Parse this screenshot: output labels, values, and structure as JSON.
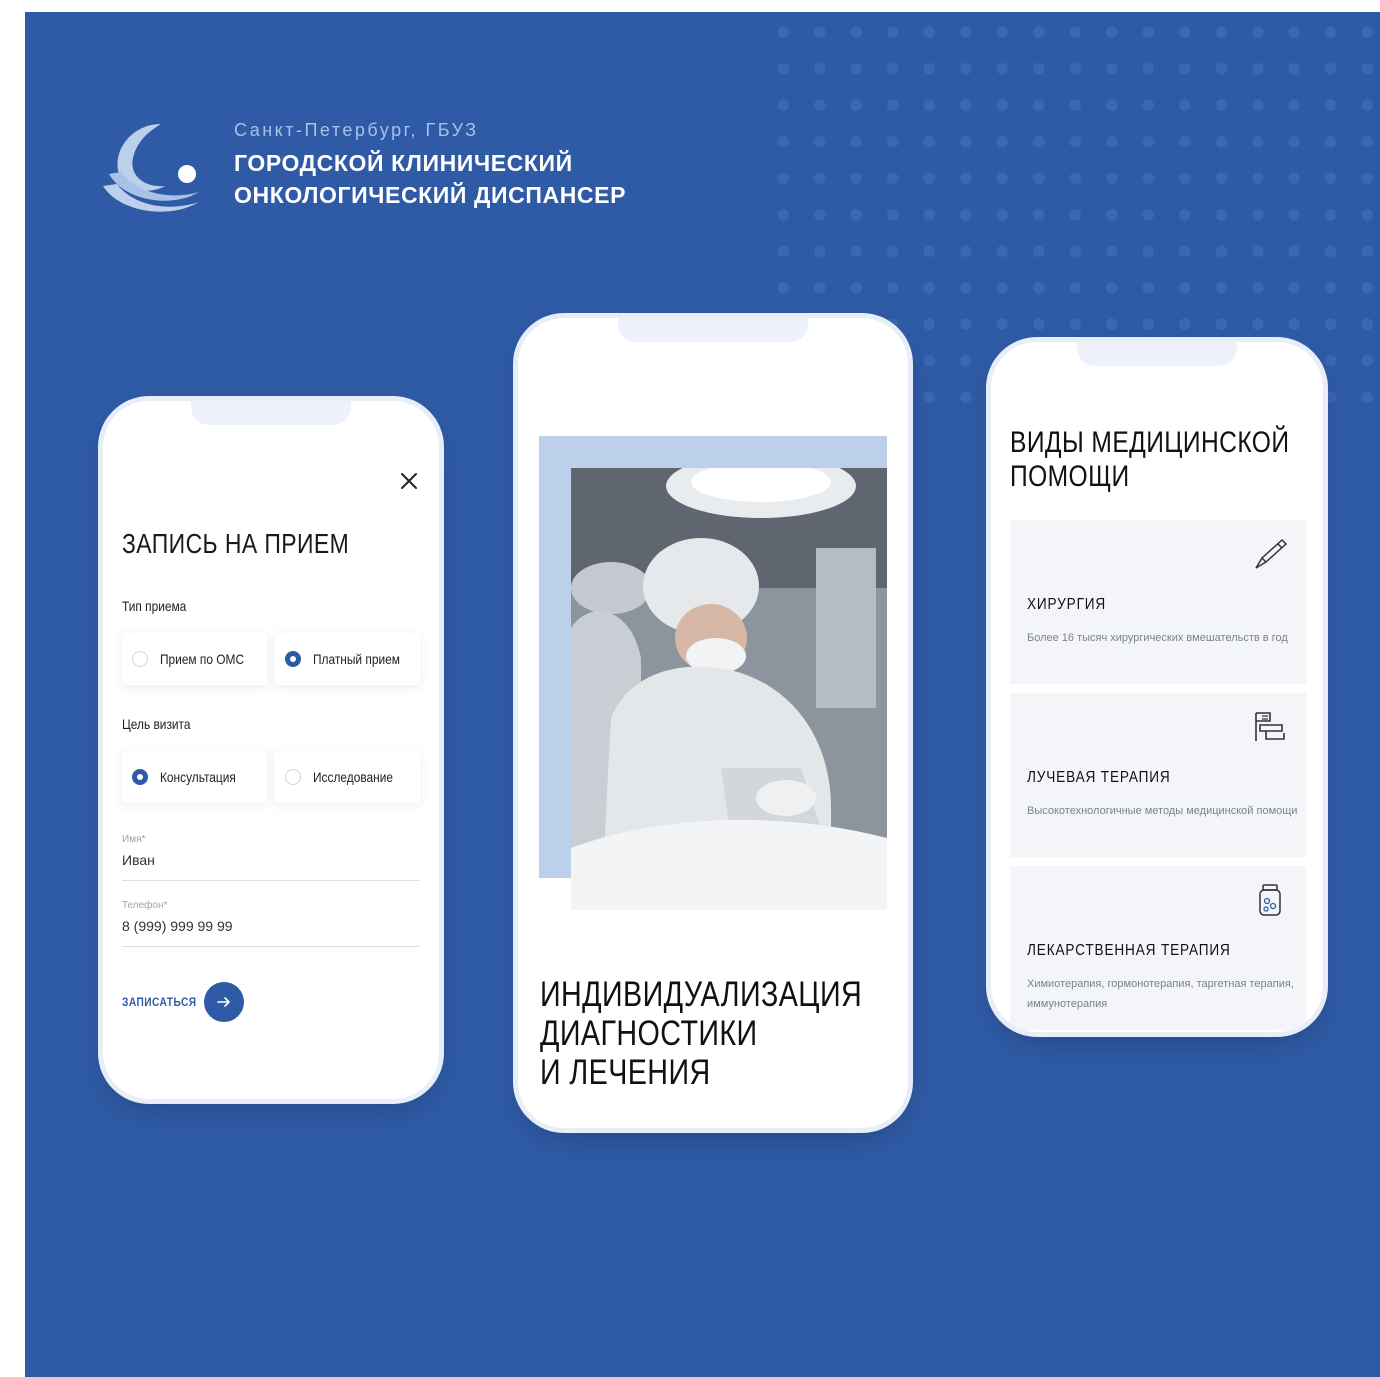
{
  "brand": {
    "subtitle": "Санкт-Петербург, ГБУЗ",
    "line1": "ГОРОДСКОЙ КЛИНИЧЕСКИЙ",
    "line2": "ОНКОЛОГИЧЕСКИЙ ДИСПАНСЕР"
  },
  "colors": {
    "background": "#2f5ba6",
    "accent": "#2f5ba6",
    "card": "#f3f5f9",
    "photo_accent": "#bcd0ec"
  },
  "appointment": {
    "title": "ЗАПИСЬ НА ПРИЕМ",
    "type_label": "Тип приема",
    "type_options": [
      {
        "label": "Прием по ОМС",
        "selected": false
      },
      {
        "label": "Платный прием",
        "selected": true
      }
    ],
    "goal_label": "Цель визита",
    "goal_options": [
      {
        "label": "Консультация",
        "selected": true
      },
      {
        "label": "Исследование",
        "selected": false
      }
    ],
    "name_field": {
      "label": "Имя*",
      "value": "Иван"
    },
    "phone_field": {
      "label": "Телефон*",
      "value": "8 (999) 999 99 99"
    },
    "submit_label": "ЗАПИСАТЬСЯ",
    "close_icon": "close-icon",
    "submit_icon": "arrow-right-icon"
  },
  "hero": {
    "title_lines": [
      "ИНДИВИДУАЛИЗАЦИЯ",
      "ДИАГНОСТИКИ",
      "И ЛЕЧЕНИЯ"
    ]
  },
  "services": {
    "title_lines": [
      "ВИДЫ МЕДИЦИНСКОЙ",
      "ПОМОЩИ"
    ],
    "items": [
      {
        "title": "ХИРУРГИЯ",
        "description": "Более 16 тысяч хирургических вмешательств в год",
        "icon": "scalpel-icon"
      },
      {
        "title": "ЛУЧЕВАЯ ТЕРАПИЯ",
        "description": "Высокотехнологичные методы медицинской помощи",
        "icon": "radiation-machine-icon"
      },
      {
        "title": "ЛЕКАРСТВЕННАЯ ТЕРАПИЯ",
        "description": "Химиотерапия, гормонотерапия, таргетная терапия, иммунотерапия",
        "icon": "medicine-jar-icon"
      }
    ]
  }
}
